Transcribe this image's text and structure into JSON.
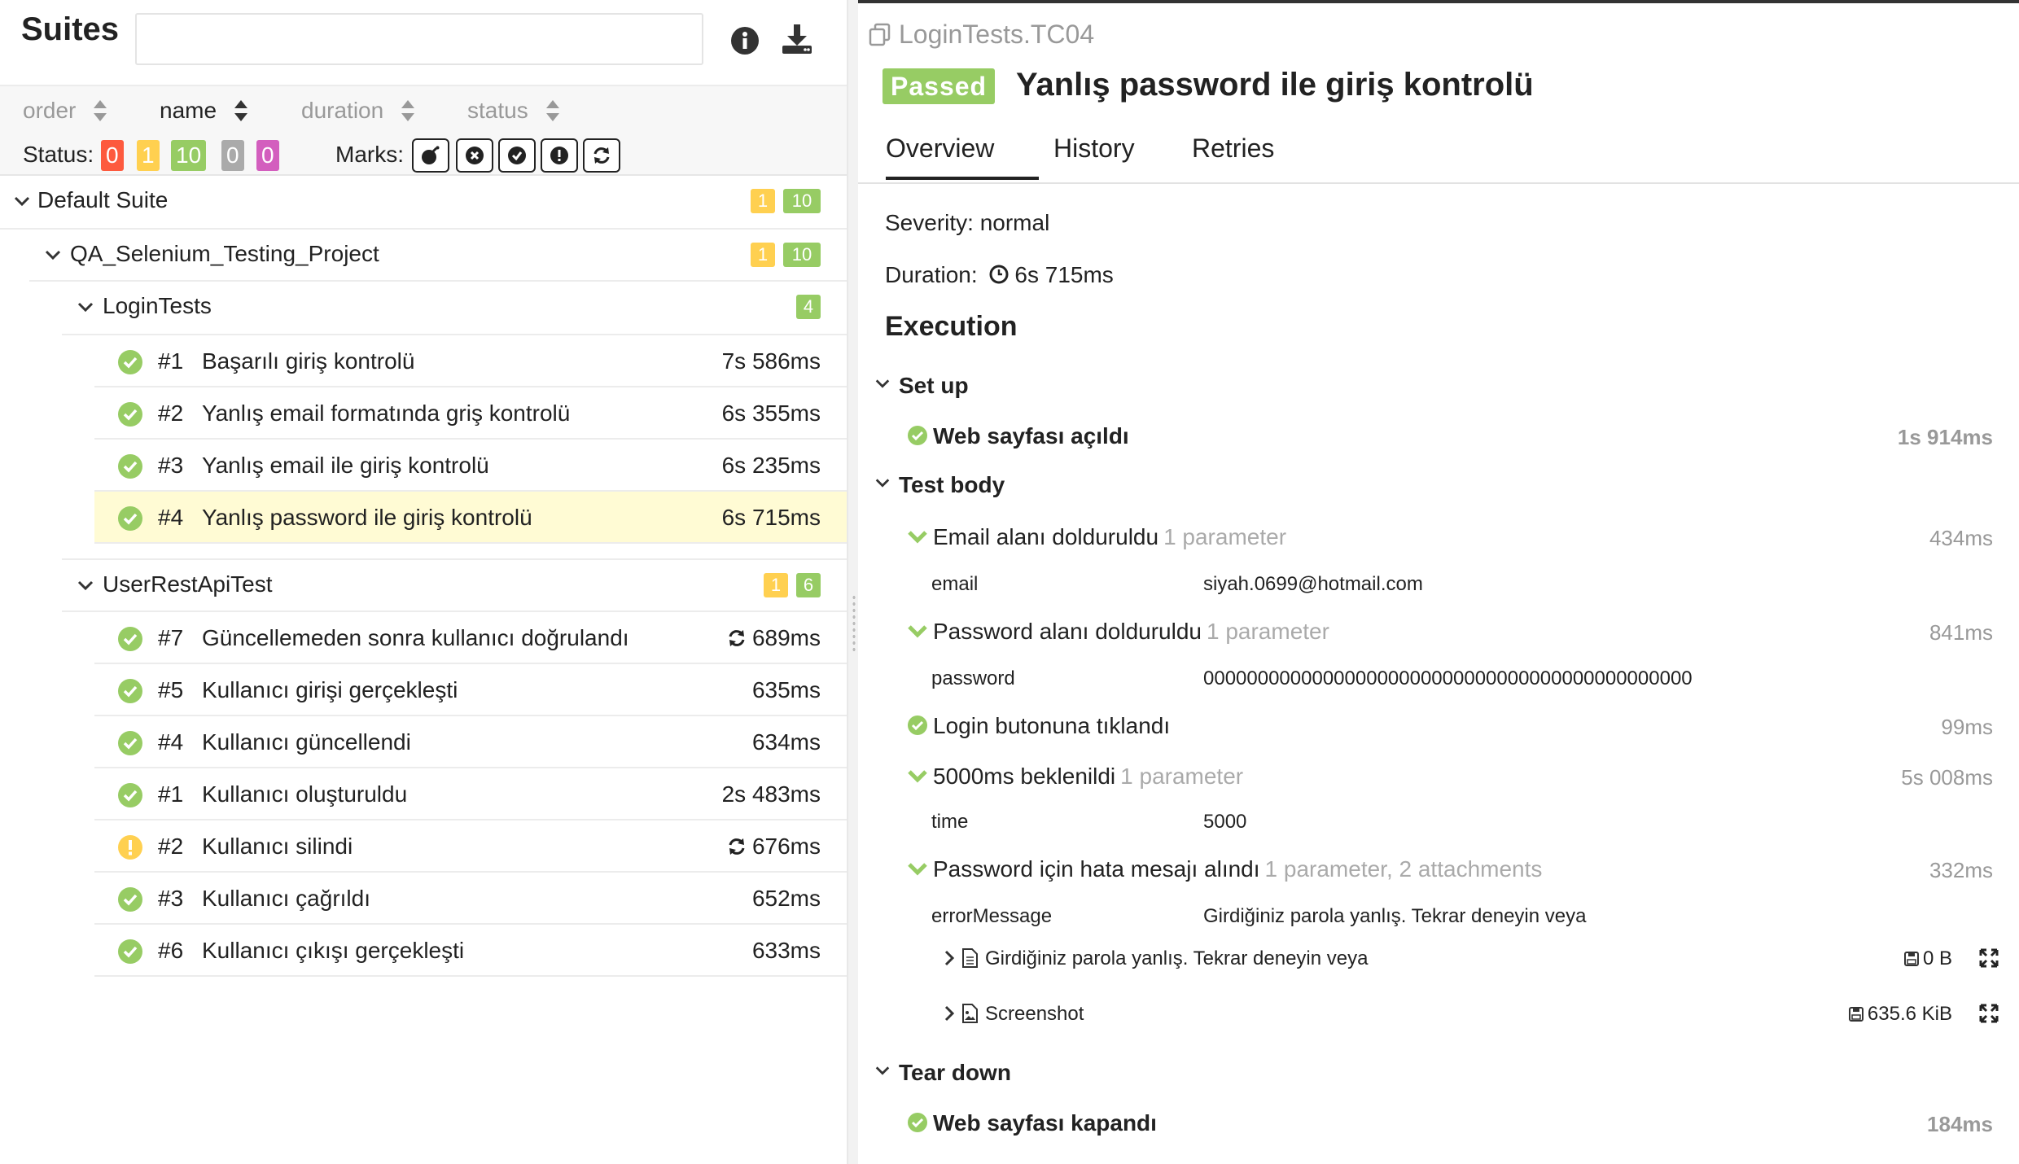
{
  "colors": {
    "passed": "#97cc64",
    "broken": "#ffd050",
    "failed": "#fd5a3e",
    "skipped": "#aaaaaa",
    "unknown": "#d35ebe"
  },
  "left": {
    "title": "Suites",
    "search_value": "",
    "sort": {
      "order": "order",
      "name": "name",
      "duration": "duration",
      "status": "status"
    },
    "status_label": "Status:",
    "status_counts": {
      "failed": "0",
      "broken": "1",
      "passed": "10",
      "skipped": "0",
      "unknown": "0"
    },
    "marks_label": "Marks:",
    "tree": {
      "default_suite": {
        "name": "Default Suite",
        "broken": "1",
        "passed": "10"
      },
      "project": {
        "name": "QA_Selenium_Testing_Project",
        "broken": "1",
        "passed": "10"
      },
      "login_tests": {
        "name": "LoginTests",
        "passed": "4",
        "tests": [
          {
            "num": "#1",
            "name": "Başarılı giriş kontrolü",
            "duration": "7s 586ms"
          },
          {
            "num": "#2",
            "name": "Yanlış email formatında griş kontrolü",
            "duration": "6s 355ms"
          },
          {
            "num": "#3",
            "name": "Yanlış email ile giriş kontrolü",
            "duration": "6s 235ms"
          },
          {
            "num": "#4",
            "name": "Yanlış password ile giriş kontrolü",
            "duration": "6s 715ms"
          }
        ]
      },
      "user_api": {
        "name": "UserRestApiTest",
        "broken": "1",
        "passed": "6",
        "tests": [
          {
            "num": "#7",
            "name": "Güncellemeden sonra kullanıcı doğrulandı",
            "duration": "689ms"
          },
          {
            "num": "#5",
            "name": "Kullanıcı girişi gerçekleşti",
            "duration": "635ms"
          },
          {
            "num": "#4",
            "name": "Kullanıcı güncellendi",
            "duration": "634ms"
          },
          {
            "num": "#1",
            "name": "Kullanıcı oluşturuldu",
            "duration": "2s 483ms"
          },
          {
            "num": "#2",
            "name": "Kullanıcı silindi",
            "duration": "676ms"
          },
          {
            "num": "#3",
            "name": "Kullanıcı çağrıldı",
            "duration": "652ms"
          },
          {
            "num": "#6",
            "name": "Kullanıcı çıkışı gerçekleşti",
            "duration": "633ms"
          }
        ]
      }
    }
  },
  "right": {
    "breadcrumb": "LoginTests.TC04",
    "status_badge": "Passed",
    "title": "Yanlış password ile giriş kontrolü",
    "tabs": {
      "overview": "Overview",
      "history": "History",
      "retries": "Retries"
    },
    "severity": "Severity: normal",
    "duration_label": "Duration:",
    "duration_value": "6s 715ms",
    "execution_title": "Execution",
    "setup": {
      "title": "Set up",
      "step": {
        "name": "Web sayfası açıldı",
        "duration": "1s 914ms"
      }
    },
    "body": {
      "title": "Test body",
      "steps": [
        {
          "name": "Email alanı dolduruldu",
          "meta": "1 parameter",
          "duration": "434ms",
          "param_key": "email",
          "param_value": "siyah.0699@hotmail.com"
        },
        {
          "name": "Password alanı dolduruldu",
          "meta": "1 parameter",
          "duration": "841ms",
          "param_key": "password",
          "param_value": "000000000000000000000000000000000000000000000"
        },
        {
          "name": "Login butonuna tıklandı",
          "duration": "99ms"
        },
        {
          "name": "5000ms beklenildi",
          "meta": "1 parameter",
          "duration": "5s 008ms",
          "param_key": "time",
          "param_value": "5000"
        },
        {
          "name": "Password için hata mesajı alındı",
          "meta": "1 parameter, 2 attachments",
          "duration": "332ms",
          "param_key": "errorMessage",
          "param_value": "Girdiğiniz parola yanlış. Tekrar deneyin veya"
        }
      ],
      "attachments": [
        {
          "name": "Girdiğiniz parola yanlış. Tekrar deneyin veya",
          "size": "0 B"
        },
        {
          "name": "Screenshot",
          "size": "635.6 KiB"
        }
      ]
    },
    "teardown": {
      "title": "Tear down",
      "step": {
        "name": "Web sayfası kapandı",
        "duration": "184ms"
      }
    }
  }
}
